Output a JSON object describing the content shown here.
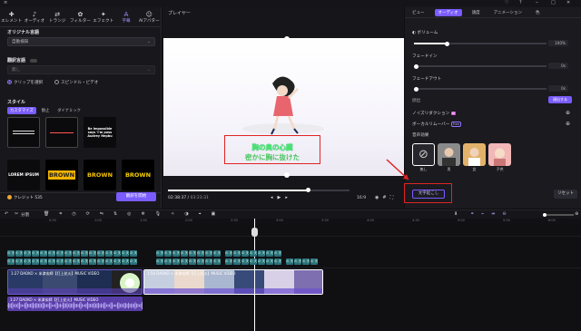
{
  "top_tabs": [
    {
      "label": "エレメント",
      "icon": "shapes-icon"
    },
    {
      "label": "オーディオ",
      "icon": "music-note-icon"
    },
    {
      "label": "トランジ",
      "icon": "transition-icon"
    },
    {
      "label": "フィルター",
      "icon": "filter-icon"
    },
    {
      "label": "エフェクト",
      "icon": "sparkle-icon"
    },
    {
      "label": "字幕",
      "icon": "subtitle-icon"
    },
    {
      "label": "AIアバター",
      "icon": "avatar-icon"
    }
  ],
  "left_panel": {
    "original_language_label": "オリジナル言語",
    "original_language_value": "自動検知",
    "translation_label": "翻訳言語",
    "translation_value": "無し",
    "radio_clip": "クリップを選択",
    "radio_speed": "スピンドル・ビデオ",
    "style_label": "スタイル",
    "style_tabs": [
      "カスタマイズ",
      "静止",
      "ダイナミック"
    ],
    "tiles": [
      "LOREM IPSUM",
      "BROWN",
      "BROWN",
      "BROWN"
    ],
    "tile_quote": "Be Impossible\nsays 'I'm poss\nAudrey Hepbu",
    "credits": "クレジット 535",
    "start_button": "翻訳を開始"
  },
  "preview": {
    "title": "プレイヤー",
    "subtitle_line1": "胸の奥の心臓",
    "subtitle_line2": "密かに胸に抜けた",
    "current_time": "02:38:37",
    "total_time": "03:23:31",
    "ratio": "16:9",
    "progress": 0.77
  },
  "right_panel": {
    "tabs": [
      "ビュー",
      "オーディオ",
      "速度",
      "アニメーション",
      "色"
    ],
    "active_tab": 1,
    "volume_label": "ボリューム",
    "volume_value": "100%",
    "fade_in_label": "フェードイン",
    "fade_in_value": "0s",
    "fade_out_label": "フェードアウト",
    "fade_out_value": "0s",
    "pitch_label": "顔出",
    "pitch_button": "顔出する",
    "noise_label": "ノイズリダクション",
    "noise_badge": "AI",
    "vocal_label": "ボーカルリムーバー",
    "vocal_badge": "Free",
    "voice_changer_label": "音声効果",
    "voices": [
      "無し",
      "男",
      "女",
      "子供"
    ],
    "subtitle_button": "文字起こし",
    "reset_button": "リセット"
  },
  "timeline": {
    "toolbar_split": "分割",
    "ruler_ticks": [
      "",
      "0:30",
      "1:00",
      "1:30",
      "2:00",
      "2:30",
      "3:00",
      "3:30",
      "4:00",
      "4:30",
      "5:00",
      "5:30",
      "6:00",
      "6:30"
    ],
    "subtitle_track_text": "の 天 胸",
    "video_clip1_title": "1:27 DAOKO × 米津玄師【打上花火】MUSIC VIDEO",
    "video_clip2_title": "1:56 DAOKO × 米津玄師【打上花火】MUSIC VIDEO",
    "audio_clip_title": "1:27 DAOKO × 米津玄師【打上花火】MUSIC VIDEO"
  }
}
